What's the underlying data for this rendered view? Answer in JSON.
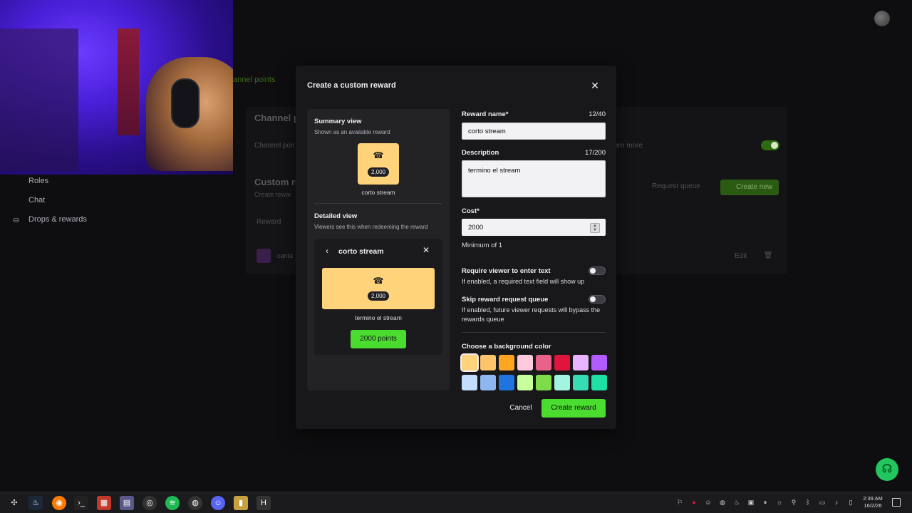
{
  "background": {
    "tab_channel_points": "annel points",
    "channel_points_title": "Channel p",
    "channel_points_row": "Channel poir",
    "learn_more": "arn more",
    "custom_rewards_title": "Custom re",
    "custom_rewards_sub": "Create rewar",
    "request_queue": "Request queue",
    "create_new": "Create new",
    "reward_header": "Reward",
    "row_text": "canta",
    "edit": "Edit"
  },
  "leftnav": {
    "items": [
      "Roles",
      "Chat",
      "Drops & rewards"
    ]
  },
  "modal": {
    "title": "Create a custom reward",
    "summary_label": "Summary view",
    "summary_sub": "Shown as an available reward",
    "summary_cost": "2,000",
    "summary_name": "corto stream",
    "detailed_label": "Detailed view",
    "detailed_sub": "Viewers see this when redeeming the reward",
    "detailed_title": "corto stream",
    "detailed_cost": "2,000",
    "detailed_desc": "termino el stream",
    "detailed_button": "2000 points",
    "reward_name_label": "Reward name*",
    "reward_name_count": "12/40",
    "reward_name_value": "corto stream",
    "description_label": "Description",
    "description_count": "17/200",
    "description_value": "termino el stream",
    "cost_label": "Cost*",
    "cost_value": "2000",
    "cost_help": "Minimum of 1",
    "require_text_label": "Require viewer to enter text",
    "require_text_help": "If enabled, a required text field will show up",
    "skip_queue_label": "Skip reward request queue",
    "skip_queue_help": "If enabled, future viewer requests will bypass the rewards queue",
    "color_label": "Choose a background color",
    "colors_row1": [
      "#ffd37a",
      "#ffc46b",
      "#ffa51f",
      "#ffc9de",
      "#e8628a",
      "#e0143c",
      "#e8b4ff",
      "#b25cff"
    ],
    "colors_row2": [
      "#c3ddff",
      "#8fb6ef",
      "#1f74e0",
      "#c6ff9c",
      "#7edc4a",
      "#a3f5e0",
      "#36dcb4",
      "#1de0a4"
    ],
    "selected_color": "#ffd37a",
    "cancel": "Cancel",
    "create": "Create reward"
  },
  "taskbar": {
    "time": "2:39 AM",
    "date": "16/2/26"
  }
}
